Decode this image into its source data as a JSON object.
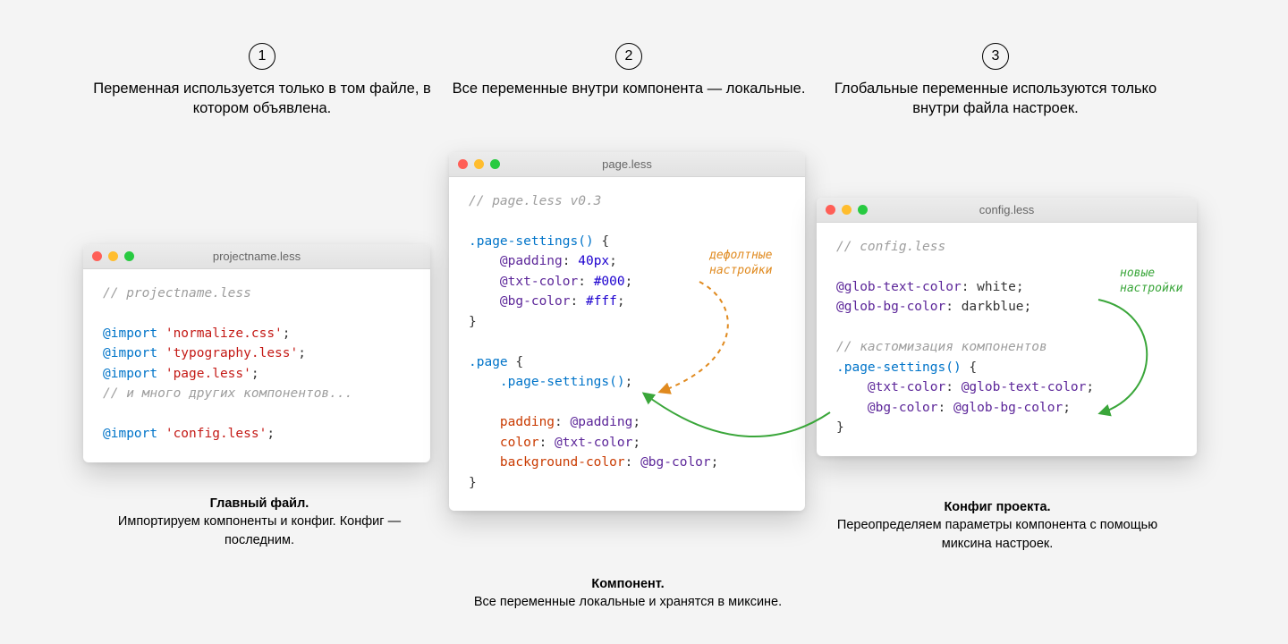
{
  "steps": [
    {
      "num": "1",
      "caption": "Переменная используется только в том файле, в котором объявлена."
    },
    {
      "num": "2",
      "caption": "Все переменные внутри компонента — локальные."
    },
    {
      "num": "3",
      "caption": "Глобальные переменные используются только внутри файла настроек."
    }
  ],
  "windows": {
    "project": {
      "title": "projectname.less",
      "code": {
        "comment1": "// projectname.less",
        "imp": "@import",
        "str_normalize": "'normalize.css'",
        "str_typo": "'typography.less'",
        "str_page": "'page.less'",
        "comment2": "// и много других компонентов...",
        "str_config": "'config.less'",
        "semi": ";"
      }
    },
    "page": {
      "title": "page.less",
      "code": {
        "comment1": "// page.less v0.3",
        "sel_settings": ".page-settings()",
        "brace_open": " {",
        "var_padding": "@padding",
        "val_40px": "40px",
        "var_txt": "@txt-color",
        "val_000": "#000",
        "var_bg": "@bg-color",
        "val_fff": "#fff",
        "brace_close": "}",
        "sel_page": ".page",
        "call_settings": ".page-settings()",
        "prop_padding": "padding",
        "prop_color": "color",
        "prop_bgcolor": "background-color",
        "colon": ":",
        "semi": ";"
      }
    },
    "config": {
      "title": "config.less",
      "code": {
        "comment1": "// config.less",
        "var_glob_text": "@glob-text-color",
        "val_white": "white",
        "var_glob_bg": "@glob-bg-color",
        "val_darkblue": "darkblue",
        "comment2": "// кастомизация компонентов",
        "sel_settings": ".page-settings()",
        "brace_open": " {",
        "var_txt": "@txt-color",
        "var_bg": "@bg-color",
        "brace_close": "}",
        "colon": ":",
        "semi": ";"
      }
    }
  },
  "annotations": {
    "defaults_line1": "дефолтные",
    "defaults_line2": "настройки",
    "new_line1": "новые",
    "new_line2": "настройки"
  },
  "footers": {
    "project_title": "Главный файл.",
    "project_body": "Импортируем компоненты и конфиг. Конфиг — последним.",
    "page_title": "Компонент.",
    "page_body": "Все переменные локальные и хранятся в миксине.",
    "config_title": "Конфиг проекта.",
    "config_body": "Переопределяем параметры компонента с помощью миксина настроек."
  }
}
